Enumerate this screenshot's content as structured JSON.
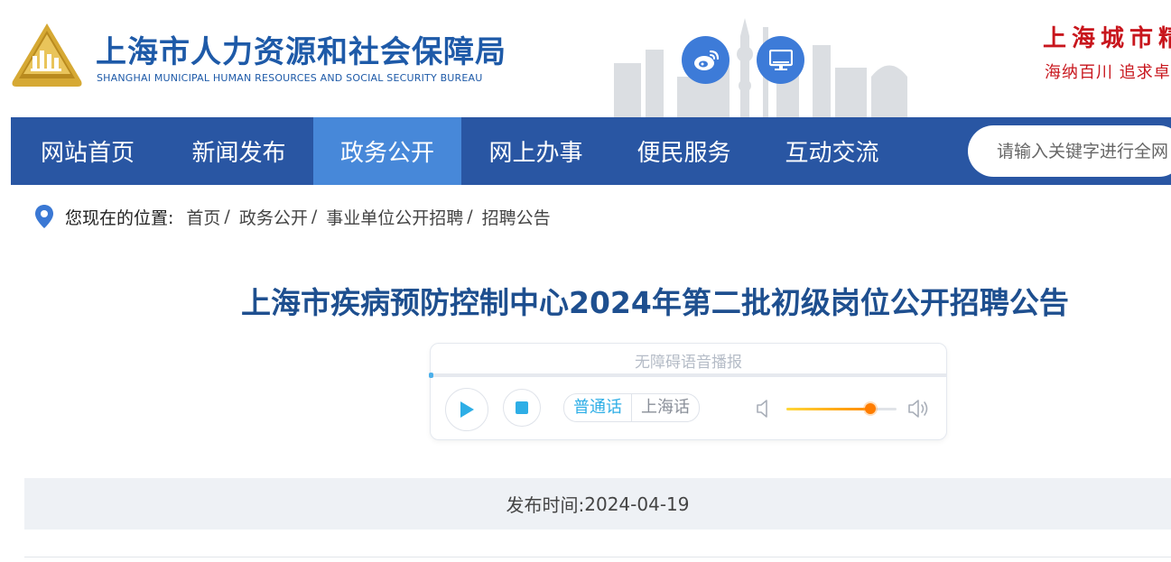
{
  "header": {
    "title_cn": "上海市人力资源和社会保障局",
    "title_en": "SHANGHAI MUNICIPAL HUMAN RESOURCES AND SOCIAL SECURITY BUREAU",
    "slogan_line1": "上海城市精",
    "slogan_line2": "海纳百川 追求卓",
    "brand_color": "#1e5aa8",
    "icons": [
      "weibo-icon",
      "pc-icon"
    ]
  },
  "nav": {
    "items": [
      {
        "label": "网站首页"
      },
      {
        "label": "新闻发布"
      },
      {
        "label": "政务公开"
      },
      {
        "label": "网上办事"
      },
      {
        "label": "便民服务"
      },
      {
        "label": "互动交流"
      }
    ],
    "active": "政务公开",
    "background": "#2956a3",
    "active_color": "#4788d9",
    "search_placeholder": "请输入关键字进行全网"
  },
  "breadcrumb": {
    "prefix": "您现在的位置:",
    "items": [
      {
        "label": "首页"
      },
      {
        "label": "政务公开"
      },
      {
        "label": "事业单位公开招聘"
      },
      {
        "label": "招聘公告"
      }
    ],
    "separator": "/"
  },
  "article": {
    "title": "上海市疾病预防控制中心2024年第二批初级岗位公开招聘公告",
    "publish_label": "发布时间:",
    "publish_date": "2024-04-19"
  },
  "player": {
    "title": "无障碍语音播报",
    "lang_options": [
      "普通话",
      "上海话"
    ],
    "selected_lang": "普通话",
    "volume_level": 0.76,
    "progress": 0
  }
}
